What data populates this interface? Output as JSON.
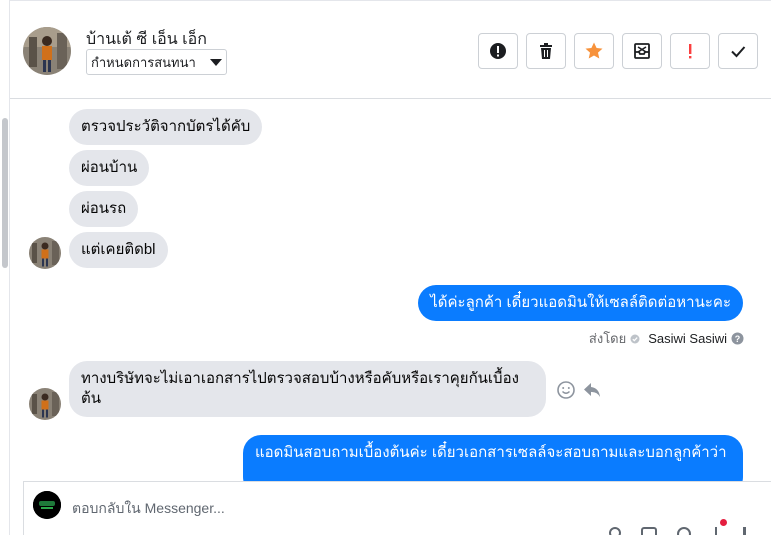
{
  "header": {
    "contact_name": "บ้านเต้ ซี เอ็น เอ็ก",
    "label_select": "กำหนดการสนทนา",
    "actions": [
      {
        "icon": "exclamation-circle-icon"
      },
      {
        "icon": "trash-icon"
      },
      {
        "icon": "star-icon",
        "color": "#f7923b"
      },
      {
        "icon": "archive-inbox-icon"
      },
      {
        "icon": "exclamation-icon",
        "color": "#fa3e3e"
      },
      {
        "icon": "check-icon"
      }
    ]
  },
  "messages": {
    "incoming": [
      "ตรวจประวัติจากบัตรได้คับ",
      "ผ่อนบ้าน",
      "ผ่อนรถ",
      "แต่เคยติดbl"
    ],
    "outgoing_1": "ได้ค่ะลูกค้า เดี๋ยวแอดมินให้เซลล์ติดต่อหานะคะ",
    "sent_by_label": "ส่งโดย",
    "sent_by_name": "Sasiwi Sasiwi",
    "incoming_long": "ทางบริษัทจะไม่เอาเอกสารไปตรวจสอบบ้างหรือคับหรือเราคุยกันเบื้องต้น",
    "outgoing_2": "แอดมินสอบถามเบื้องต้นค่ะ เดี๋ยวเอกสารเซลล์จะสอบถามและบอกลูกค้าว่า"
  },
  "composer": {
    "placeholder": "ตอบกลับใน Messenger..."
  },
  "colors": {
    "outgoing_bubble": "#0a7cff",
    "incoming_bubble": "#e4e6eb",
    "star": "#f7923b",
    "alert": "#fa3e3e"
  }
}
